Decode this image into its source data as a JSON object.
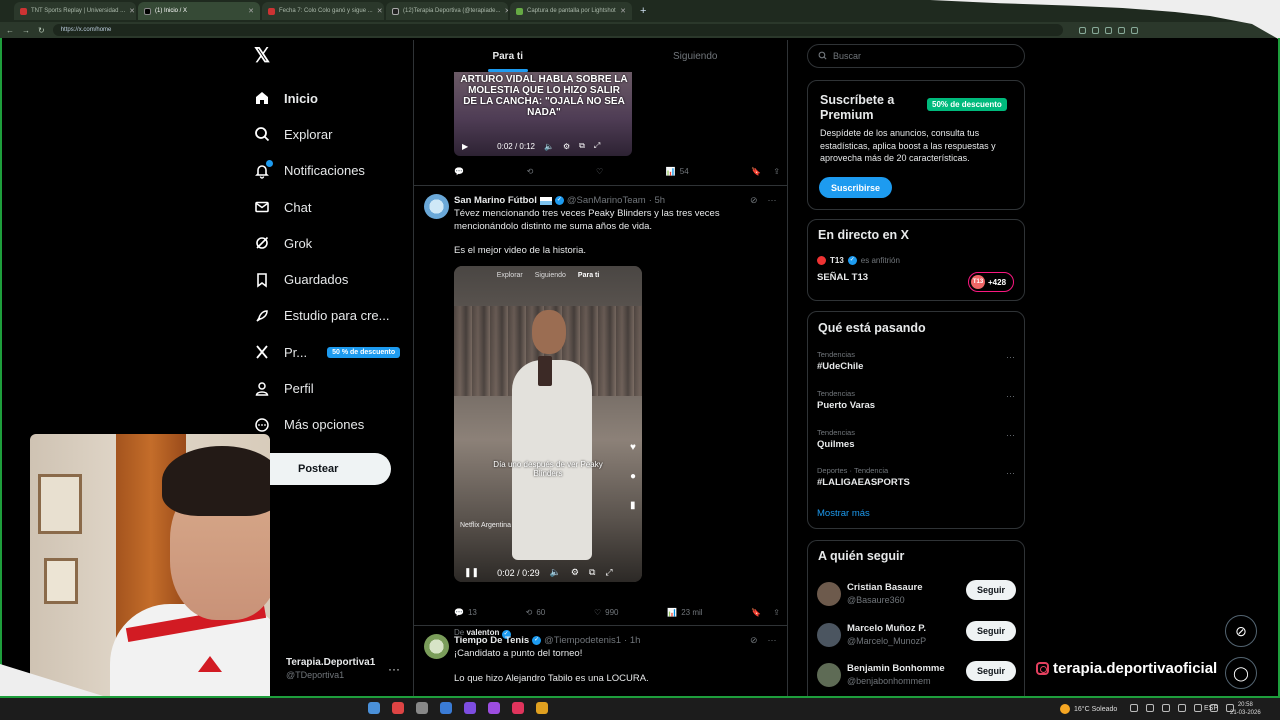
{
  "browser": {
    "tabs": [
      {
        "label": "TNT Sports Replay | Universidad ...",
        "active": false
      },
      {
        "label": "(1) Inicio / X",
        "active": true
      },
      {
        "label": "Fecha 7: Colo Colo ganó y sigue ...",
        "active": false
      },
      {
        "label": "(12)Terapia Deportiva (@terapiade...",
        "active": false
      },
      {
        "label": "Captura de pantalla por Lightshot",
        "active": false
      }
    ],
    "url": "https://x.com/home"
  },
  "nav": {
    "items": [
      {
        "label": "Inicio",
        "icon": "home-icon"
      },
      {
        "label": "Explorar",
        "icon": "search-icon"
      },
      {
        "label": "Notificaciones",
        "icon": "bell-icon"
      },
      {
        "label": "Chat",
        "icon": "mail-icon"
      },
      {
        "label": "Grok",
        "icon": "grok-icon"
      },
      {
        "label": "Guardados",
        "icon": "bookmark-icon"
      },
      {
        "label": "Estudio para cre...",
        "icon": "rocket-icon"
      },
      {
        "label": "Pr...",
        "icon": "x-premium-icon"
      },
      {
        "label": "Perfil",
        "icon": "user-icon"
      },
      {
        "label": "Más opciones",
        "icon": "more-circle-icon"
      }
    ],
    "premium_badge": "50 % de descuento",
    "post_button": "Postear",
    "account": {
      "name": "Terapia.Deportiva1",
      "handle": "@TDeportiva1"
    }
  },
  "feed": {
    "tabs": [
      "Para ti",
      "Siguiendo"
    ],
    "tweet1": {
      "video_headline": "ARTURO VIDAL HABLA SOBRE LA MOLESTIA QUE LO HIZO SALIR DE LA CANCHA: \"OJALÁ NO SEA NADA\"",
      "video_time": "0:02 / 0:12",
      "views": "54"
    },
    "tweet2": {
      "name": "San Marino Fútbol",
      "handle": "@SanMarinoTeam",
      "time": "· 5h",
      "text1": "Tévez mencionando tres veces Peaky Blinders y las tres veces mencionándolo distinto me suma años de vida.",
      "text2": "Es el mejor video de la historia.",
      "video_tabs": [
        "Explorar",
        "Siguiendo",
        "Para ti"
      ],
      "video_caption": "Día uno después de ver Peaky Blinders",
      "video_channel": "Netflix Argentina",
      "video_time": "0:02 / 0:29",
      "from_prefix": "De",
      "from_user": "valenton",
      "replies": "13",
      "reposts": "60",
      "likes": "990",
      "views": "23 mil"
    },
    "tweet3": {
      "name": "Tiempo De Tenis",
      "handle": "@Tiempodetenis1",
      "time": "· 1h",
      "text1": "¡Candidato a punto del torneo!",
      "text2": "Lo que hizo Alejandro Tabilo es una LOCURA."
    }
  },
  "right": {
    "search_placeholder": "Buscar",
    "premium": {
      "title": "Suscríbete a Premium",
      "badge": "50% de descuento",
      "text": "Despídete de los anuncios, consulta tus estadísticas, aplica boost a las respuestas y aprovecha más de 20 características.",
      "button": "Suscribirse"
    },
    "live": {
      "title": "En directo en X",
      "host": "T13",
      "host_suffix": "es anfitrión",
      "channel": "SEÑAL T13",
      "count": "+428"
    },
    "trends": {
      "title": "Qué está pasando",
      "items": [
        {
          "context": "Tendencias",
          "name": "#UdeChile"
        },
        {
          "context": "Tendencias",
          "name": "Puerto Varas"
        },
        {
          "context": "Tendencias",
          "name": "Quilmes"
        },
        {
          "context": "Deportes · Tendencia",
          "name": "#LALIGAEASPORTS"
        }
      ],
      "show_more": "Mostrar más"
    },
    "follow": {
      "title": "A quién seguir",
      "button": "Seguir",
      "users": [
        {
          "name": "Cristian Basaure",
          "handle": "@Basaure360"
        },
        {
          "name": "Marcelo Muñoz P.",
          "handle": "@Marcelo_MunozP"
        },
        {
          "name": "Benjamin Bonhomme",
          "handle": "@benjabonhommem"
        }
      ]
    }
  },
  "overlay": {
    "social_handle": "terapia.deportivaoficial"
  },
  "taskbar": {
    "weather": "16°C  Soleado",
    "lang": "ESP",
    "time": "20:58",
    "date": "21-03-2026"
  }
}
